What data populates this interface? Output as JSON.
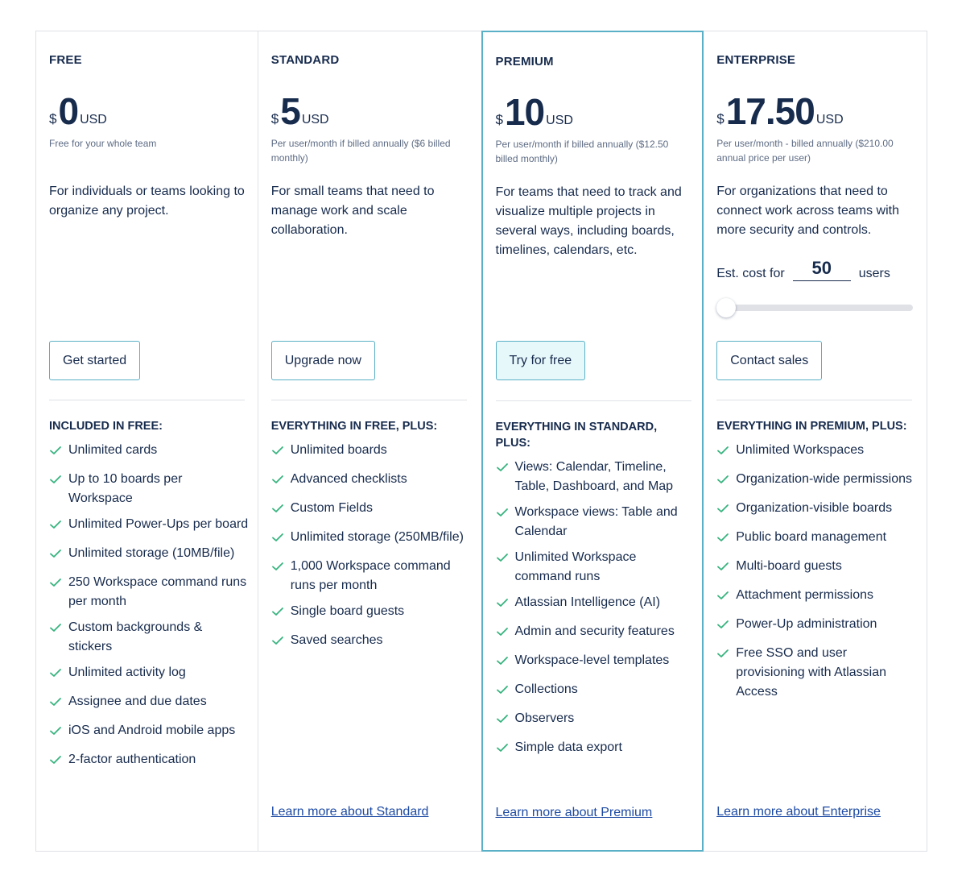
{
  "plans": [
    {
      "id": "free",
      "name": "FREE",
      "currency_symbol": "$",
      "price": "0",
      "currency": "USD",
      "price_note": "Free for your whole team",
      "description": "For individuals or teams looking to organize any project.",
      "cta_label": "Get started",
      "features_title": "INCLUDED IN FREE:",
      "features": [
        "Unlimited cards",
        "Up to 10 boards per Workspace",
        "Unlimited Power-Ups per board",
        "Unlimited storage (10MB/file)",
        "250 Workspace command runs per month",
        "Custom backgrounds & stickers",
        "Unlimited activity log",
        "Assignee and due dates",
        "iOS and Android mobile apps",
        "2-factor authentication"
      ]
    },
    {
      "id": "standard",
      "name": "STANDARD",
      "currency_symbol": "$",
      "price": "5",
      "currency": "USD",
      "price_note": "Per user/month if billed annually ($6 billed monthly)",
      "description": "For small teams that need to manage work and scale collaboration.",
      "cta_label": "Upgrade now",
      "features_title": "EVERYTHING IN FREE, PLUS:",
      "features": [
        "Unlimited boards",
        "Advanced checklists",
        "Custom Fields",
        "Unlimited storage (250MB/file)",
        "1,000 Workspace command runs per month",
        "Single board guests",
        "Saved searches"
      ],
      "learn_more": "Learn more about Standard"
    },
    {
      "id": "premium",
      "name": "PREMIUM",
      "currency_symbol": "$",
      "price": "10",
      "currency": "USD",
      "price_note": "Per user/month if billed annually ($12.50 billed monthly)",
      "description": "For teams that need to track and visualize multiple projects in several ways, including boards, timelines, calendars, etc.",
      "cta_label": "Try for free",
      "features_title": "EVERYTHING IN STANDARD, PLUS:",
      "features": [
        "Views: Calendar, Timeline, Table, Dashboard, and Map",
        "Workspace views: Table and Calendar",
        "Unlimited Workspace command runs",
        "Atlassian Intelligence (AI)",
        "Admin and security features",
        "Workspace-level templates",
        "Collections",
        "Observers",
        "Simple data export"
      ],
      "learn_more": "Learn more about Premium"
    },
    {
      "id": "enterprise",
      "name": "ENTERPRISE",
      "currency_symbol": "$",
      "price": "17.50",
      "currency": "USD",
      "price_note": "Per user/month - billed annually ($210.00 annual price per user)",
      "description": "For organizations that need to connect work across teams with more security and controls.",
      "estimate": {
        "prefix": "Est. cost for",
        "users_value": "50",
        "suffix": "users",
        "slider_fraction": 0
      },
      "cta_label": "Contact sales",
      "features_title": "EVERYTHING IN PREMIUM, PLUS:",
      "features": [
        "Unlimited Workspaces",
        "Organization-wide permissions",
        "Organization-visible boards",
        "Public board management",
        "Multi-board guests",
        "Attachment permissions",
        "Power-Up administration",
        "Free SSO and user provisioning with Atlassian Access"
      ],
      "learn_more": "Learn more about Enterprise"
    }
  ],
  "colors": {
    "text": "#172b4d",
    "muted": "#5e6c84",
    "check": "#36b37e",
    "accent_border": "#5ab0c6",
    "premium_button_bg": "#e7f8fb",
    "link": "#1d4aa3"
  }
}
